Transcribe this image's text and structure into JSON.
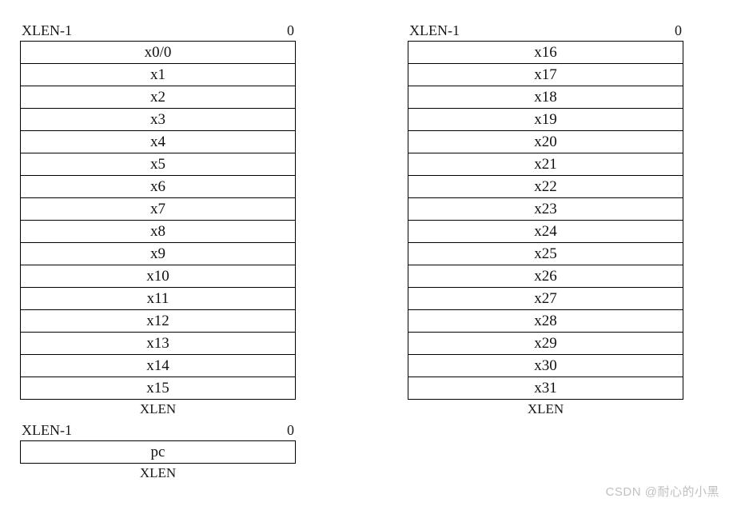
{
  "labels": {
    "msb": "XLEN-1",
    "lsb": "0",
    "width": "XLEN"
  },
  "left_registers": [
    "x0/0",
    "x1",
    "x2",
    "x3",
    "x4",
    "x5",
    "x6",
    "x7",
    "x8",
    "x9",
    "x10",
    "x11",
    "x12",
    "x13",
    "x14",
    "x15"
  ],
  "right_registers": [
    "x16",
    "x17",
    "x18",
    "x19",
    "x20",
    "x21",
    "x22",
    "x23",
    "x24",
    "x25",
    "x26",
    "x27",
    "x28",
    "x29",
    "x30",
    "x31"
  ],
  "pc_register": "pc",
  "watermark": "CSDN @耐心的小黑"
}
